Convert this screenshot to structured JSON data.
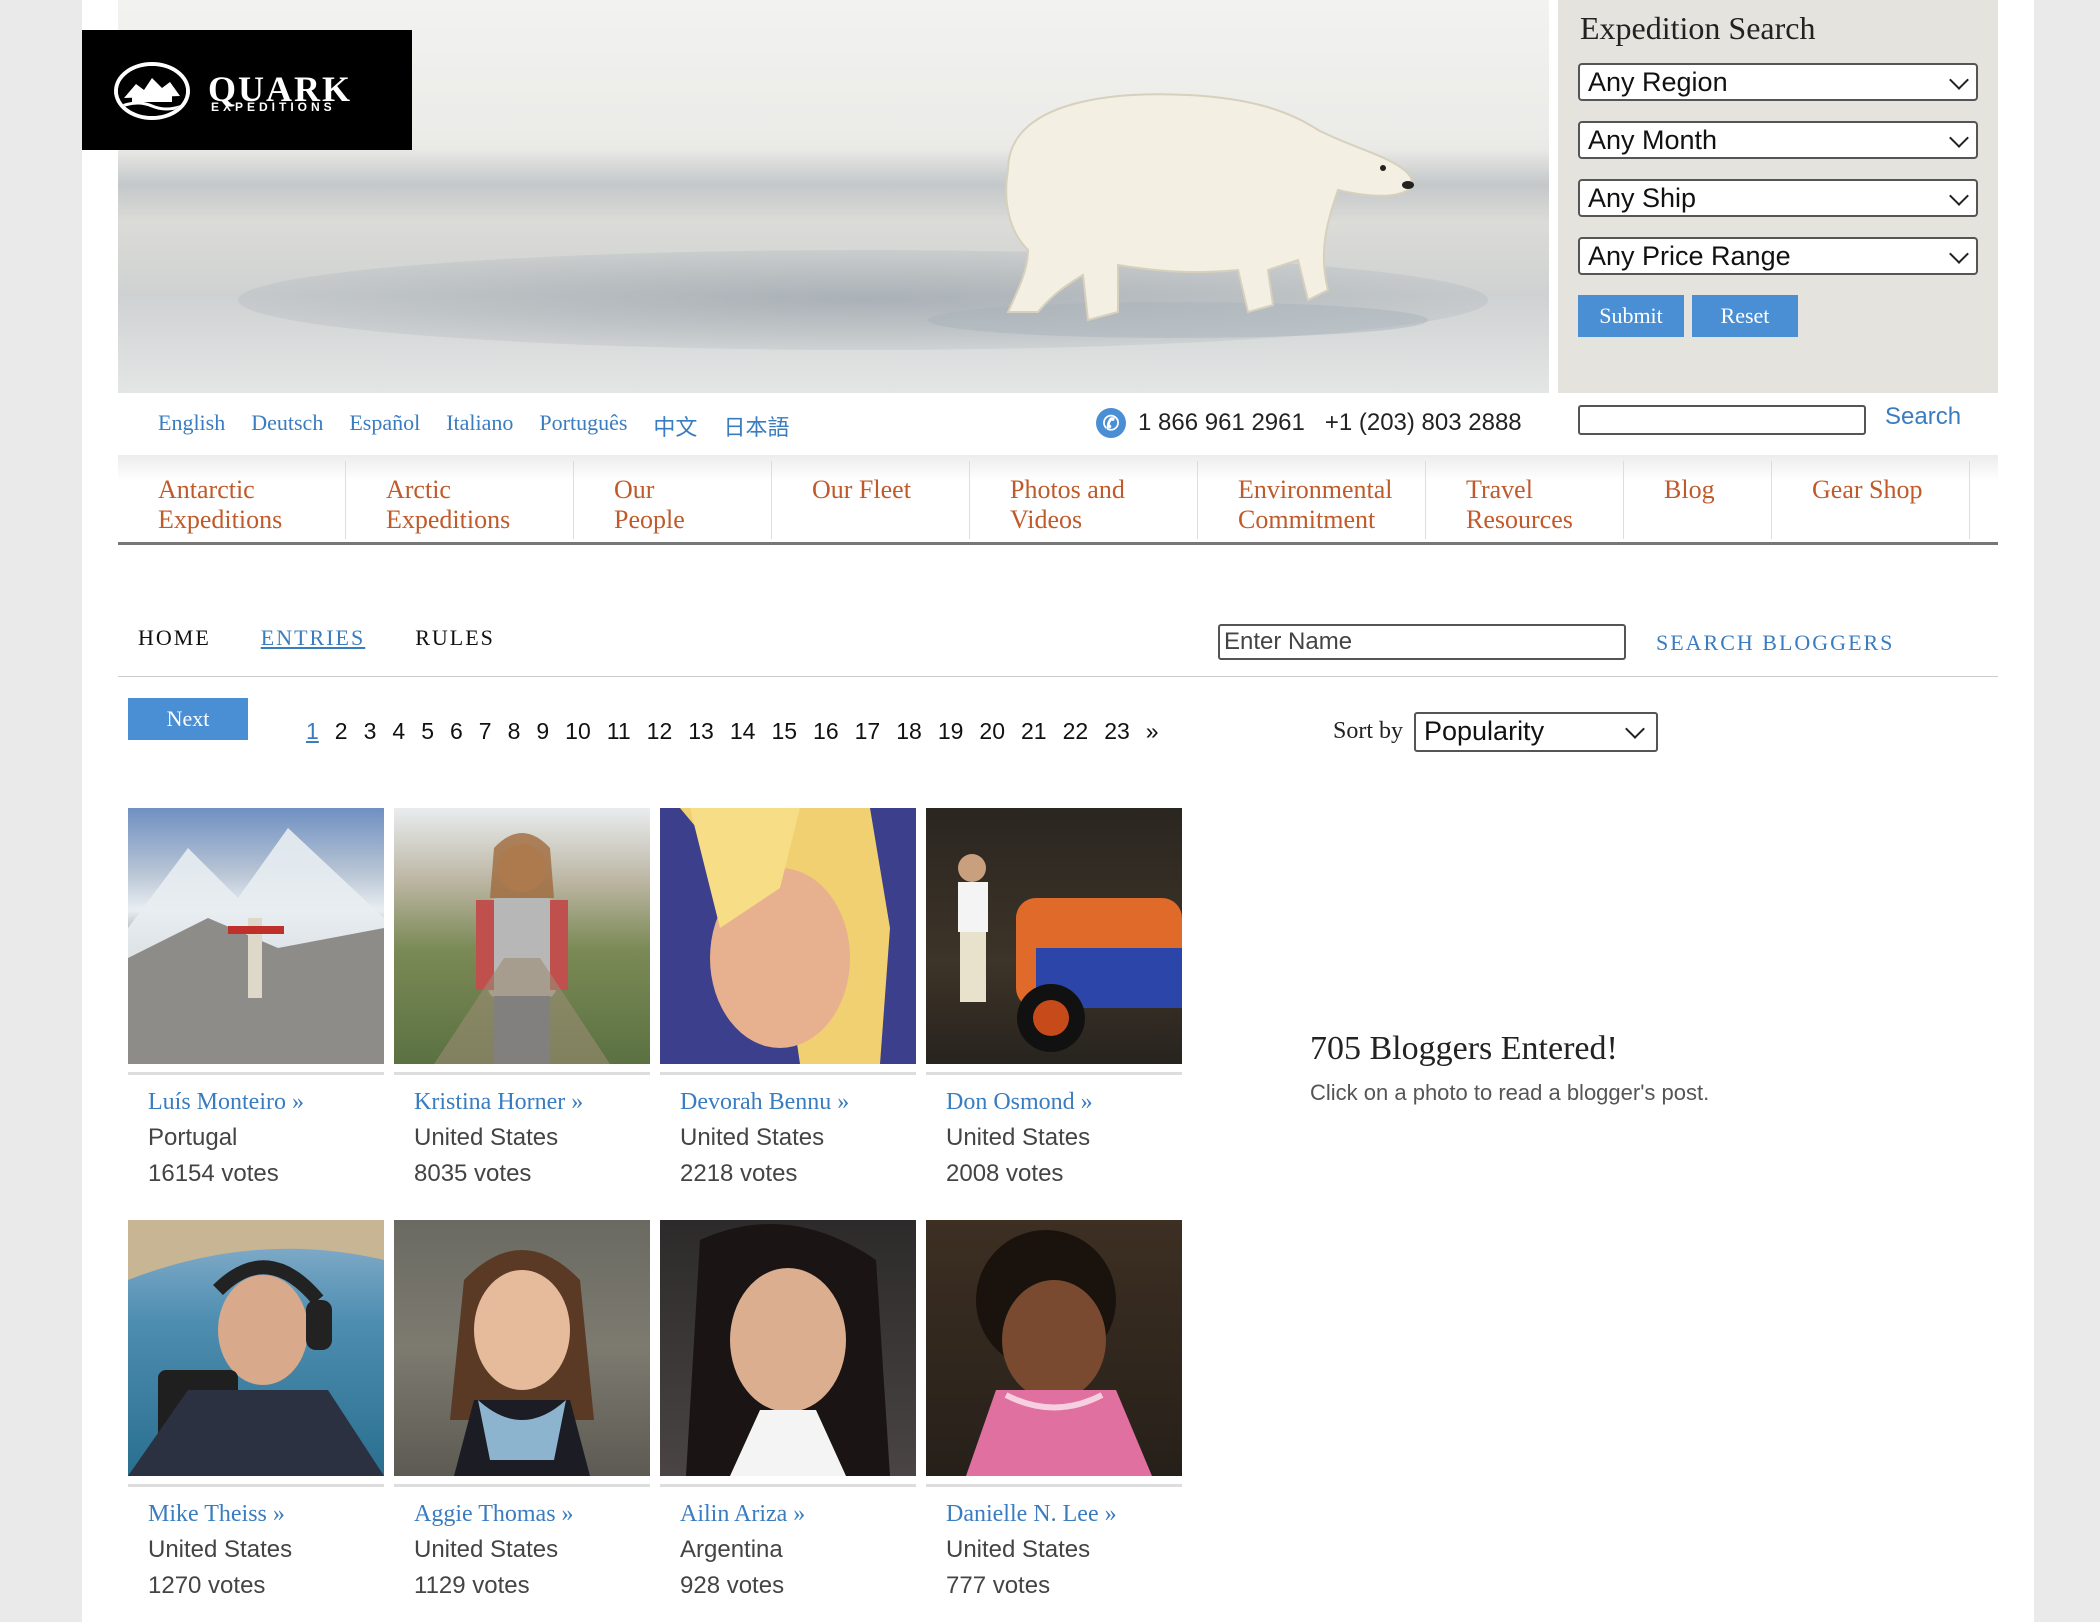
{
  "brand": {
    "name": "QUARK",
    "tagline": "EXPEDITIONS"
  },
  "expedition_search": {
    "title": "Expedition Search",
    "region": "Any Region",
    "month": "Any Month",
    "ship": "Any Ship",
    "price": "Any Price Range",
    "submit": "Submit",
    "reset": "Reset"
  },
  "languages": [
    "English",
    "Deutsch",
    "Español",
    "Italiano",
    "Português",
    "中文",
    "日本語"
  ],
  "phone": {
    "icon": "phone-icon",
    "us": "1 866 961 2961",
    "intl": "+1 (203) 803 2888"
  },
  "site_search": {
    "label": "Search"
  },
  "main_nav": [
    "Antarctic Expeditions",
    "Arctic Expeditions",
    "Our People",
    "Our Fleet",
    "Photos and Videos",
    "Environmental Commitment",
    "Travel Resources",
    "Blog",
    "Gear Shop"
  ],
  "sub_nav": {
    "home": "HOME",
    "entries": "ENTRIES",
    "rules": "RULES"
  },
  "blogger_search": {
    "placeholder": "Enter Name",
    "label": "SEARCH BLOGGERS"
  },
  "pager": {
    "next": "Next",
    "pages": [
      "1",
      "2",
      "3",
      "4",
      "5",
      "6",
      "7",
      "8",
      "9",
      "10",
      "11",
      "12",
      "13",
      "14",
      "15",
      "16",
      "17",
      "18",
      "19",
      "20",
      "21",
      "22",
      "23",
      "»"
    ],
    "current": "1"
  },
  "sort": {
    "label": "Sort by",
    "value": "Popularity"
  },
  "entries": [
    {
      "name": "Luís Monteiro »",
      "country": "Portugal",
      "votes": "16154 votes"
    },
    {
      "name": "Kristina Horner »",
      "country": "United States",
      "votes": "8035 votes"
    },
    {
      "name": "Devorah Bennu »",
      "country": "United States",
      "votes": "2218 votes"
    },
    {
      "name": "Don Osmond »",
      "country": "United States",
      "votes": "2008 votes"
    },
    {
      "name": "Mike Theiss »",
      "country": "United States",
      "votes": "1270 votes"
    },
    {
      "name": "Aggie Thomas »",
      "country": "United States",
      "votes": "1129 votes"
    },
    {
      "name": "Ailin Ariza »",
      "country": "Argentina",
      "votes": "928 votes"
    },
    {
      "name": "Danielle N. Lee »",
      "country": "United States",
      "votes": "777 votes"
    }
  ],
  "summary": {
    "count": "705 Bloggers Entered!",
    "hint": "Click on a photo to read a blogger's post."
  }
}
